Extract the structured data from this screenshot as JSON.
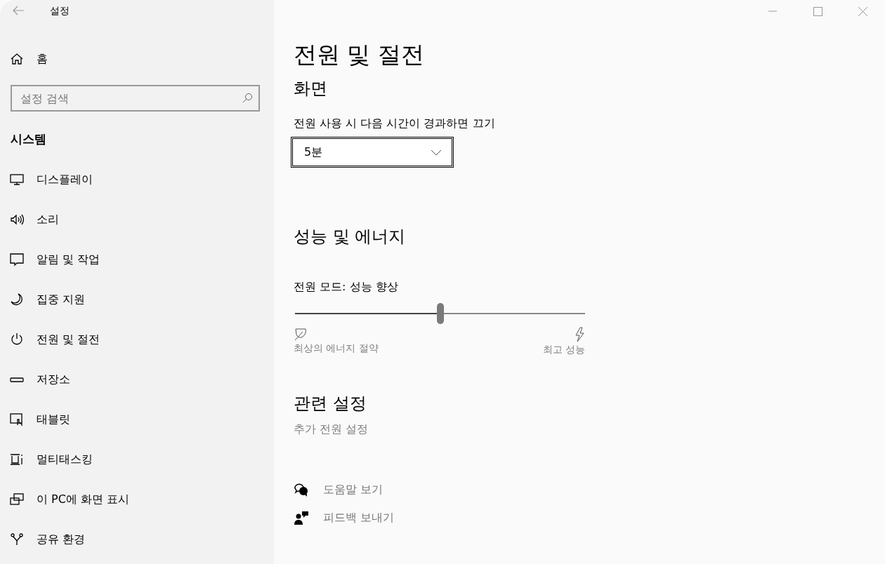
{
  "window": {
    "title": "설정"
  },
  "sidebar": {
    "home": "홈",
    "search": {
      "placeholder": "설정 검색"
    },
    "section": "시스템",
    "items": [
      {
        "label": "디스플레이",
        "kind": "display"
      },
      {
        "label": "소리",
        "kind": "sound"
      },
      {
        "label": "알림 및 작업",
        "kind": "notify"
      },
      {
        "label": "집중 지원",
        "kind": "moon"
      },
      {
        "label": "전원 및 절전",
        "kind": "power"
      },
      {
        "label": "저장소",
        "kind": "storage"
      },
      {
        "label": "태블릿",
        "kind": "tablet"
      },
      {
        "label": "멀티태스킹",
        "kind": "multitask"
      },
      {
        "label": "이 PC에 화면 표시",
        "kind": "project"
      },
      {
        "label": "공유 환경",
        "kind": "share"
      }
    ]
  },
  "page": {
    "title": "전원 및 절전",
    "screen": {
      "heading": "화면",
      "label": "전원 사용 시 다음 시간이 경과하면 끄기",
      "value": "5분"
    },
    "energy": {
      "heading": "성능 및 에너지",
      "label": "전원 모드: 성능 향상",
      "level": 0.5,
      "min_label": "최상의 에너지 절약",
      "max_label": "최고 성능"
    },
    "related": {
      "heading": "관련 설정",
      "link": "추가 전원 설정"
    },
    "help": [
      {
        "label": "도움말 보기",
        "kind": "help"
      },
      {
        "label": "피드백 보내기",
        "kind": "feedback"
      }
    ]
  }
}
